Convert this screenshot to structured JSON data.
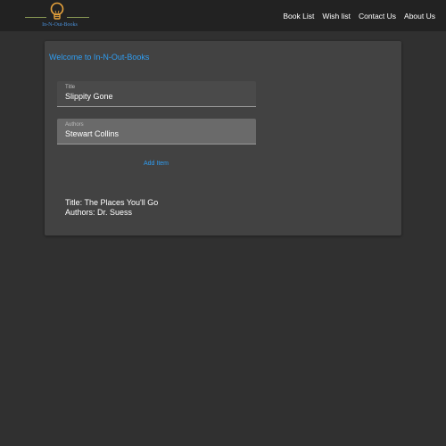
{
  "header": {
    "logo_text": "In-N-Out-Books",
    "nav": [
      {
        "label": "Book List"
      },
      {
        "label": "Wish list"
      },
      {
        "label": "Contact Us"
      },
      {
        "label": "About Us"
      }
    ]
  },
  "main": {
    "welcome": "Welcome to In-N-Out-Books",
    "title_field": {
      "label": "Title",
      "value": "Slippity Gone"
    },
    "authors_field": {
      "label": "Authors",
      "value": "Stewart Collins"
    },
    "add_button": "Add Item",
    "book": {
      "title_line": "Title: The Places You'll Go",
      "authors_line": "Authors: Dr. Suess"
    }
  },
  "colors": {
    "accent": "#2f9cf0",
    "bulb": "#e8a33c",
    "background": "#303030",
    "topbar": "#222222",
    "card": "#424242"
  }
}
